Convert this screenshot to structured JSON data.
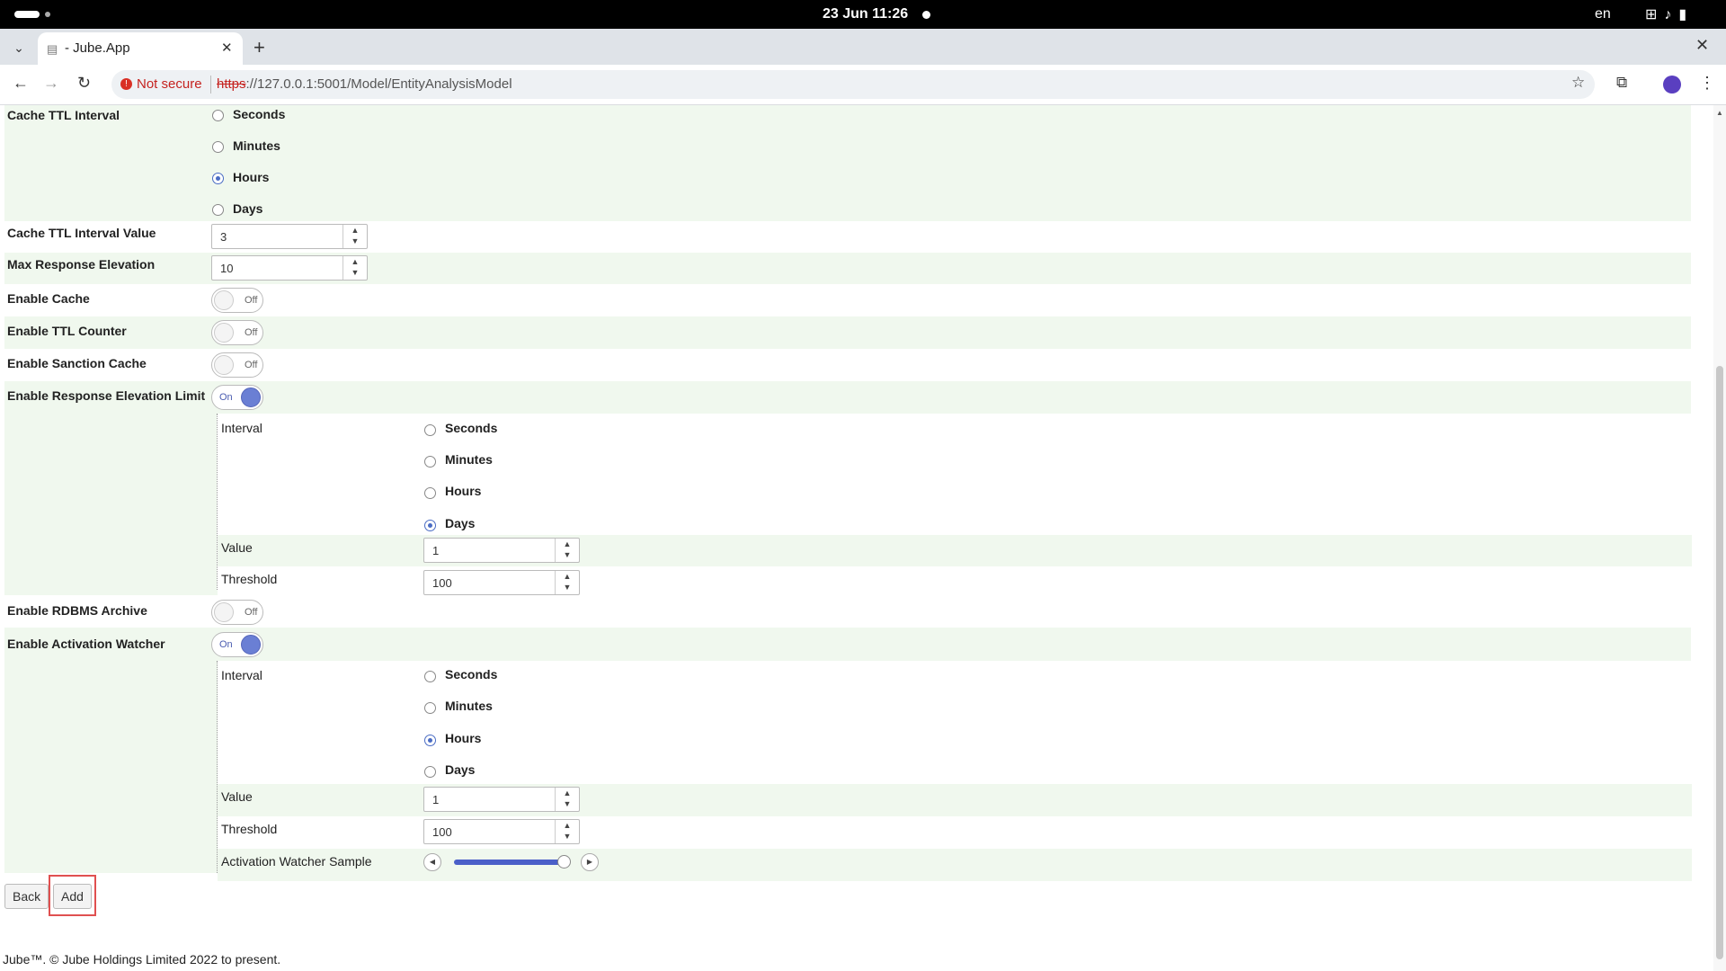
{
  "os": {
    "datetime": "23 Jun  11:26",
    "lang": "en"
  },
  "browser": {
    "tab_title": "- Jube.App",
    "not_secure": "Not secure",
    "url_scheme": "https",
    "url_rest": "://127.0.0.1:5001/Model/EntityAnalysisModel"
  },
  "form": {
    "cache_ttl_interval": {
      "label": "Cache TTL Interval",
      "options": [
        "Seconds",
        "Minutes",
        "Hours",
        "Days"
      ],
      "selected": "Hours"
    },
    "cache_ttl_interval_value": {
      "label": "Cache TTL Interval Value",
      "value": "3"
    },
    "max_response_elevation": {
      "label": "Max Response Elevation",
      "value": "10"
    },
    "enable_cache": {
      "label": "Enable Cache",
      "state": "Off"
    },
    "enable_ttl_counter": {
      "label": "Enable TTL Counter",
      "state": "Off"
    },
    "enable_sanction_cache": {
      "label": "Enable Sanction Cache",
      "state": "Off"
    },
    "enable_response_elevation_limit": {
      "label": "Enable Response Elevation Limit",
      "state": "On",
      "interval_label": "Interval",
      "options": [
        "Seconds",
        "Minutes",
        "Hours",
        "Days"
      ],
      "selected": "Days",
      "value_label": "Value",
      "value": "1",
      "threshold_label": "Threshold",
      "threshold": "100"
    },
    "enable_rdbms_archive": {
      "label": "Enable RDBMS Archive",
      "state": "Off"
    },
    "enable_activation_watcher": {
      "label": "Enable Activation Watcher",
      "state": "On",
      "interval_label": "Interval",
      "options": [
        "Seconds",
        "Minutes",
        "Hours",
        "Days"
      ],
      "selected": "Hours",
      "value_label": "Value",
      "value": "1",
      "threshold_label": "Threshold",
      "threshold": "100",
      "sample_label": "Activation Watcher Sample",
      "sample_level": 0.95
    }
  },
  "buttons": {
    "back": "Back",
    "add": "Add"
  },
  "footer": "Jube™. © Jube Holdings Limited 2022 to present."
}
